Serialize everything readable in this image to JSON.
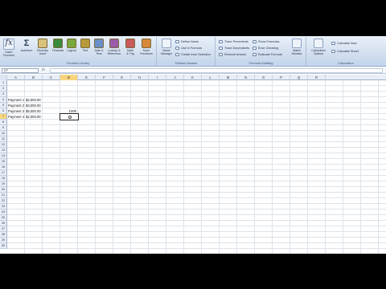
{
  "ribbon": {
    "groups": [
      {
        "label": "Function Library"
      },
      {
        "label": "Defined Names"
      },
      {
        "label": "Formula Auditing"
      },
      {
        "label": "Calculation"
      }
    ],
    "buttons": {
      "insert_function": "Insert\nFunction",
      "autosum": "AutoSum",
      "recently_used": "Recently\nUsed",
      "financial": "Financial",
      "logical": "Logical",
      "text": "Text",
      "date_time": "Date &\nTime",
      "lookup_reference": "Lookup &\nReference",
      "math_trig": "Math\n& Trig",
      "more_functions": "More\nFunctions",
      "name_manager": "Name\nManager",
      "define_name": "Define Name",
      "use_in_formula": "Use in Formula",
      "create_from_selection": "Create from Selection",
      "trace_precedents": "Trace Precedents",
      "trace_dependents": "Trace Dependents",
      "remove_arrows": "Remove Arrows",
      "show_formulas": "Show Formulas",
      "error_checking": "Error Checking",
      "evaluate_formula": "Evaluate Formula",
      "watch_window": "Watch\nWindow",
      "calculation_options": "Calculation\nOptions",
      "calculate_now": "Calculate Now",
      "calculate_sheet": "Calculate Sheet"
    },
    "colors": {
      "financial": "#3c8a3c",
      "logical": "#7aa83a",
      "text": "#b89a3a",
      "date_time": "#6b8fc8",
      "lookup_reference": "#9a5ca8",
      "math_trig": "#c85a5a",
      "more_functions": "#d8883a"
    }
  },
  "formula_bar": {
    "name_box": "D7",
    "fx_label": "fx",
    "value": ""
  },
  "columns": [
    "A",
    "B",
    "C",
    "D",
    "E",
    "F",
    "G",
    "H",
    "I",
    "J",
    "K",
    "L",
    "M",
    "N",
    "O",
    "P",
    "Q",
    "R"
  ],
  "selected_column": "D",
  "rows": [
    "1",
    "2",
    "3",
    "4",
    "5",
    "6",
    "7",
    "8",
    "9",
    "10",
    "11",
    "12",
    "13",
    "14",
    "15",
    "16",
    "17",
    "18",
    "19",
    "20",
    "21",
    "22",
    "23",
    "24",
    "25",
    "26",
    "27",
    "28",
    "29",
    "30"
  ],
  "selected_row": "7",
  "cells": {
    "a4": "Payment 1",
    "b4": "$2,000.00",
    "a5": "Payment 2",
    "b5": "$3,000.00",
    "a6": "Payment 3",
    "b6": "$5,000.00",
    "a7": "Payment 4",
    "b7": "$2,000.00",
    "d6": "1000"
  }
}
